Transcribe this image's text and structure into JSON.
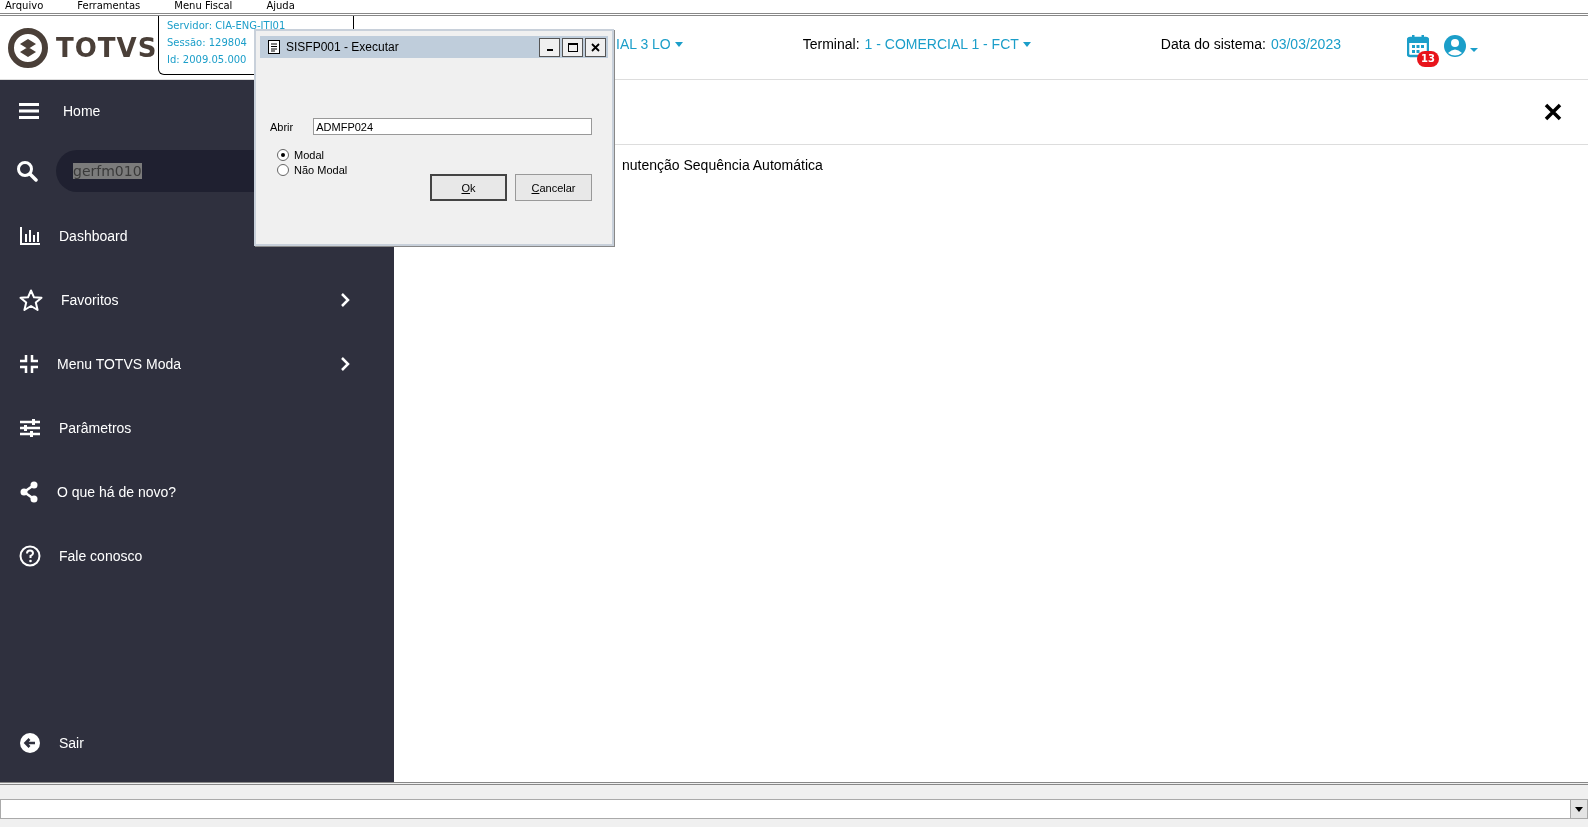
{
  "menubar": [
    "Arquivo",
    "Ferramentas",
    "Menu Fiscal",
    "Ajuda"
  ],
  "header": {
    "logo": "TOTVS",
    "server_info": [
      "Servidor: CIA-ENG-ITI01",
      "Sessão: 129804",
      "Id: 2009.05.000"
    ],
    "company": "IAL 3 LO",
    "terminal_label": "Terminal:",
    "terminal": "1 - COMERCIAL 1 - FCT",
    "date_label": "Data do sistema:",
    "date": "03/03/2023",
    "notifications": "13"
  },
  "sidebar": {
    "home": "Home",
    "search": {
      "value": "gerfm010"
    },
    "items": [
      {
        "label": "Dashboard",
        "kind": "chart",
        "has_submenu": false
      },
      {
        "label": "Favoritos",
        "kind": "star",
        "has_submenu": true
      },
      {
        "label": "Menu TOTVS Moda",
        "kind": "compress",
        "has_submenu": true
      },
      {
        "label": "Parâmetros",
        "kind": "sliders",
        "has_submenu": false
      },
      {
        "label": "O que há de novo?",
        "kind": "share",
        "has_submenu": false
      },
      {
        "label": "Fale conosco",
        "kind": "help",
        "has_submenu": false
      }
    ],
    "logout": "Sair"
  },
  "content": {
    "result": "nutenção Sequência Automática"
  },
  "dialog": {
    "title": "SISFP001 - Executar",
    "field_label": "Abrir",
    "field_value": "ADMFP024",
    "options": [
      {
        "label": "Modal",
        "selected": true
      },
      {
        "label": "Não Modal",
        "selected": false
      }
    ],
    "buttons": [
      "Ok",
      "Cancelar"
    ]
  }
}
